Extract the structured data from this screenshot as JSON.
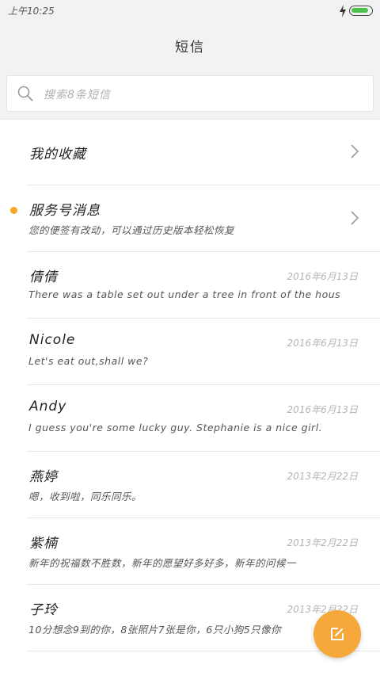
{
  "status": {
    "time": "上午10:25",
    "battery_level": 0.9
  },
  "header": {
    "title": "短信"
  },
  "search": {
    "placeholder": "搜索8条短信"
  },
  "colors": {
    "accent": "#f6a83a",
    "unread": "#f6a623",
    "battery": "#4cc24a"
  },
  "favorites": {
    "label": "我的收藏"
  },
  "service": {
    "title": "服务号消息",
    "preview": "您的便签有改动，可以通过历史版本轻松恢复",
    "unread": true
  },
  "conversations": [
    {
      "name": "倩倩",
      "preview": "There was a table set out under a tree in front of the hous",
      "date": "2016年6月13日"
    },
    {
      "name": "Nicole",
      "preview": "Let's eat out,shall we?",
      "date": "2016年6月13日"
    },
    {
      "name": "Andy",
      "preview": "I guess you're some lucky guy. Stephanie is a nice girl.",
      "date": "2016年6月13日"
    },
    {
      "name": "燕婷",
      "preview": "嗯，收到啦，同乐同乐。",
      "date": "2013年2月22日"
    },
    {
      "name": "紫楠",
      "preview": "新年的祝福数不胜数，新年的愿望好多好多，新年的问候一",
      "date": "2013年2月22日"
    },
    {
      "name": "子玲",
      "preview": "10分想念9到的你，8张照片7张是你，6只小狗5只像你",
      "date": "2013年2月22日"
    }
  ],
  "icons": {
    "search": "search-icon",
    "chevron": "chevron-right-icon",
    "compose": "compose-icon",
    "bolt": "charging-bolt-icon",
    "battery": "battery-icon"
  }
}
